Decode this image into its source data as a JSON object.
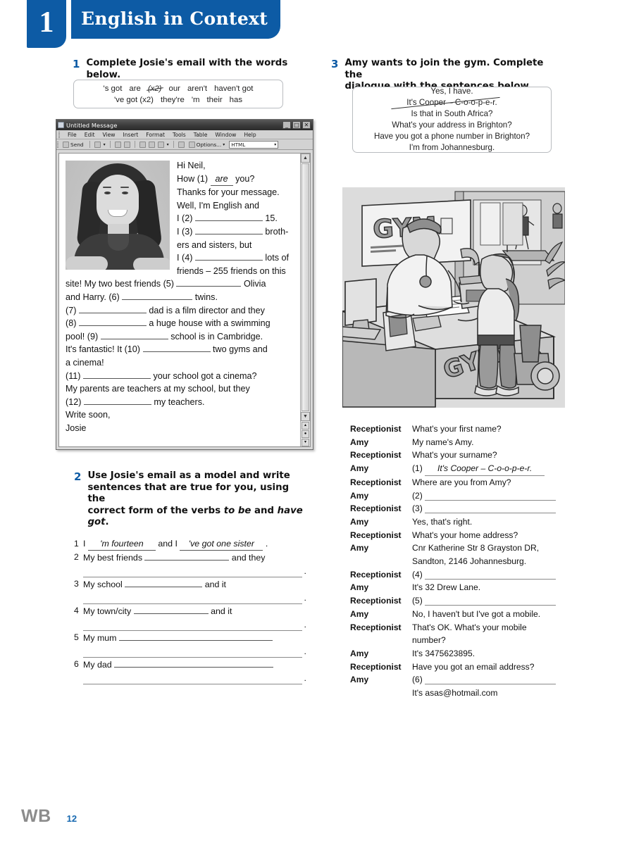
{
  "banner": {
    "unit_number": "1",
    "title": "English in Context"
  },
  "exercise1": {
    "number": "1",
    "instruction": "Complete Josie's email with the words below.",
    "wordbank": {
      "row1_pre": "'s got",
      "row1_are": "are",
      "row1_are_x2": "(x2)",
      "row1_rest": [
        "our",
        "aren't",
        "haven't got"
      ],
      "row2": [
        "'ve got (x2)",
        "they're",
        "'m",
        "their",
        "has"
      ]
    },
    "email": {
      "window_title": "Untitled Message",
      "menu": [
        "File",
        "Edit",
        "View",
        "Insert",
        "Format",
        "Tools",
        "Table",
        "Window",
        "Help"
      ],
      "toolbar": {
        "send": "Send",
        "options": "Options...",
        "format": "HTML"
      },
      "window_buttons": {
        "minimize": "_",
        "maximize": "□",
        "close": "✕"
      },
      "greeting": "Hi Neil,",
      "line_how_pre": "How (1)",
      "line_how_answer": "are",
      "line_how_post": "you?",
      "line_thanks": "Thanks for your message.",
      "line_well": "Well, I'm English and",
      "b2_pre": "I (2)",
      "b2_post": "15.",
      "b3_pre": "I (3)",
      "b3_post": "broth-",
      "b3_cont": "ers and sisters, but",
      "b4_pre": "I (4)",
      "b4_post": "lots of",
      "b4_cont": "friends – 255 friends on this",
      "b5_pre": "site! My two best friends (5)",
      "b5_post": "Olivia",
      "b6_pre": "and Harry. (6)",
      "b6_post": "twins.",
      "b7_pre": "(7)",
      "b7_post": "dad is a film director and they",
      "b8_pre": "(8)",
      "b8_post": "a huge house with a swimming",
      "b9_pre": "pool! (9)",
      "b9_post": "school is in Cambridge.",
      "b10_pre": "It's fantastic! It (10)",
      "b10_post": "two gyms and",
      "b10_cont": "a cinema!",
      "b11_pre": "(11)",
      "b11_post": "your school got a cinema?",
      "b11_cont": "My parents are teachers at my school, but they",
      "b12_pre": "(12)",
      "b12_post": "my teachers.",
      "sign_off": "Write soon,",
      "signature": "Josie"
    }
  },
  "exercise2": {
    "number": "2",
    "instruction_a": "Use Josie's email as a model and write",
    "instruction_b": "sentences that are true for you, using the",
    "instruction_c_pre": "correct form of the verbs ",
    "instruction_c_it1": "to be",
    "instruction_c_mid": " and ",
    "instruction_c_it2": "have got",
    "instruction_c_end": ".",
    "items": [
      {
        "n": "1",
        "pre": "I",
        "answer1": "'m fourteen",
        "mid": "and I",
        "answer2": "'ve got one sister",
        "end": ".",
        "second_line": false
      },
      {
        "n": "2",
        "pre": "My best friends",
        "mid": "and they",
        "end": ".",
        "second_line": true
      },
      {
        "n": "3",
        "pre": "My school",
        "mid": "and it",
        "end": ".",
        "second_line": true
      },
      {
        "n": "4",
        "pre": "My town/city",
        "mid": "and it",
        "end": ".",
        "second_line": true
      },
      {
        "n": "5",
        "pre": "My mum",
        "mid": "",
        "end": ".",
        "second_line": true
      },
      {
        "n": "6",
        "pre": "My dad",
        "mid": "",
        "end": ".",
        "second_line": true
      }
    ]
  },
  "exercise3": {
    "number": "3",
    "instruction_a": "Amy wants to join the gym. Complete the",
    "instruction_b": "dialogue with the sentences below.",
    "sentences": [
      "Yes, I have.",
      "It's Cooper – C-o-o-p-e-r.",
      "Is that in South Africa?",
      "What's your address in Brighton?",
      "Have you got a phone number in Brighton?",
      "I'm from Johannesburg."
    ],
    "struck_sentence_index": 1,
    "picture": {
      "sign_text": "GYM",
      "desk_text": "GYM",
      "alt": "gym reception desk with receptionist and girl"
    },
    "dialogue": [
      {
        "speaker": "Receptionist",
        "text": "What's your first name?",
        "blank": "",
        "answer": ""
      },
      {
        "speaker": "Amy",
        "text": "My name's Amy.",
        "blank": "",
        "answer": ""
      },
      {
        "speaker": "Receptionist",
        "text": "What's your surname?",
        "blank": "",
        "answer": ""
      },
      {
        "speaker": "Amy",
        "text": "",
        "blank": "(1)",
        "answer": "It's Cooper – C-o-o-p-e-r."
      },
      {
        "speaker": "Receptionist",
        "text": "Where are you from Amy?",
        "blank": "",
        "answer": ""
      },
      {
        "speaker": "Amy",
        "text": "",
        "blank": "(2)",
        "answer": ""
      },
      {
        "speaker": "Receptionist",
        "text": "",
        "blank": "(3)",
        "answer": ""
      },
      {
        "speaker": "Amy",
        "text": "Yes, that's right.",
        "blank": "",
        "answer": ""
      },
      {
        "speaker": "Receptionist",
        "text": "What's your home address?",
        "blank": "",
        "answer": ""
      },
      {
        "speaker": "Amy",
        "text": "Cnr Katherine Str 8 Grayston DR,",
        "text2": "Sandton, 2146 Johannesburg.",
        "blank": "",
        "answer": ""
      },
      {
        "speaker": "Receptionist",
        "text": "",
        "blank": "(4)",
        "answer": ""
      },
      {
        "speaker": "Amy",
        "text": "It's 32 Drew Lane.",
        "blank": "",
        "answer": ""
      },
      {
        "speaker": "Receptionist",
        "text": "",
        "blank": "(5)",
        "answer": ""
      },
      {
        "speaker": "Amy",
        "text": "No, I haven't but I've got a mobile.",
        "blank": "",
        "answer": ""
      },
      {
        "speaker": "Receptionist",
        "text": "That's OK. What's your mobile",
        "text2": "number?",
        "blank": "",
        "answer": ""
      },
      {
        "speaker": "Amy",
        "text": "It's 3475623895.",
        "blank": "",
        "answer": ""
      },
      {
        "speaker": "Receptionist",
        "text": "Have you got an email address?",
        "blank": "",
        "answer": ""
      },
      {
        "speaker": "Amy",
        "text": "",
        "text2": "It's asas@hotmail.com",
        "blank": "(6)",
        "answer": ""
      }
    ]
  },
  "footer": {
    "book_code": "WB",
    "page_number": "12"
  },
  "colors": {
    "brand_blue": "#0d5ba5",
    "page_blue": "#1668b0",
    "footer_gray": "#8c8c8c"
  }
}
